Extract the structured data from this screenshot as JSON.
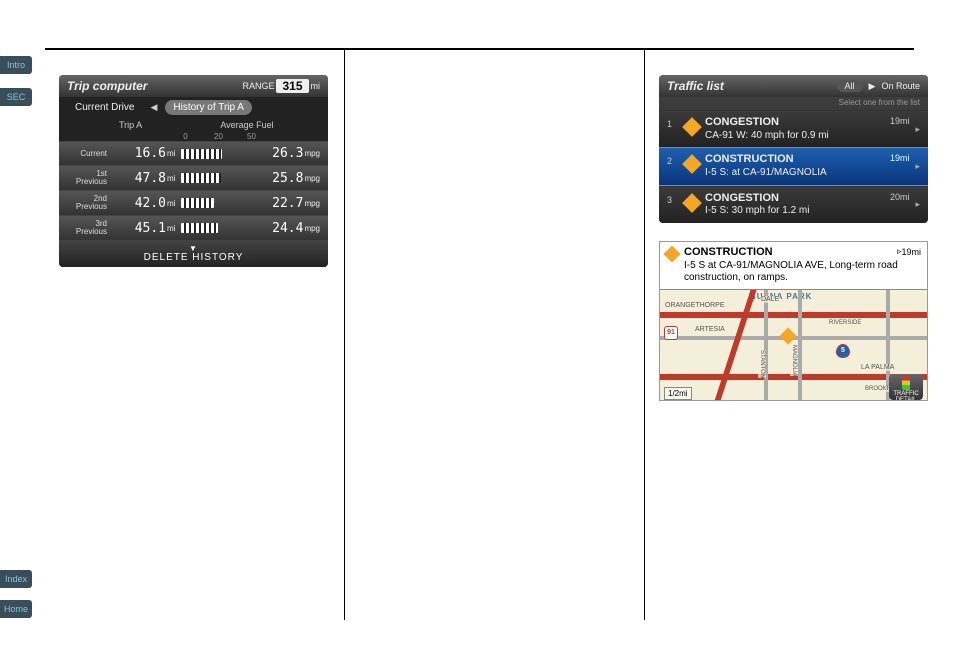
{
  "sideTabs": {
    "intro": "Intro",
    "sec": "SEC",
    "index": "Index",
    "home": "Home"
  },
  "tripComputer": {
    "title": "Trip computer",
    "rangeLabel": "RANGE",
    "rangeValue": "315",
    "rangeUnit": "mi",
    "tabLeft": "Current Drive",
    "tabRight": "History of Trip A",
    "colA": "Trip A",
    "colB": "Average Fuel",
    "scale": [
      "0",
      "20",
      "50"
    ],
    "rows": [
      {
        "label": "Current",
        "dist": "16.6",
        "distUnit": "mi",
        "mpg": "26.3",
        "mpgUnit": "mpg"
      },
      {
        "label": "1st Previous",
        "dist": "47.8",
        "distUnit": "mi",
        "mpg": "25.8",
        "mpgUnit": "mpg"
      },
      {
        "label": "2nd Previous",
        "dist": "42.0",
        "distUnit": "mi",
        "mpg": "22.7",
        "mpgUnit": "mpg"
      },
      {
        "label": "3rd Previous",
        "dist": "45.1",
        "distUnit": "mi",
        "mpg": "24.4",
        "mpgUnit": "mpg"
      }
    ],
    "footer": "DELETE HISTORY"
  },
  "trafficList": {
    "title": "Traffic list",
    "filterAll": "All",
    "filterRoute": "On Route",
    "subtitle": "Select one from the list",
    "items": [
      {
        "num": "1",
        "title": "CONGESTION",
        "desc": "CA-91 W: 40 mph for 0.9 mi",
        "dist": "19mi",
        "selected": false
      },
      {
        "num": "2",
        "title": "CONSTRUCTION",
        "desc": "I-5 S: at CA-91/MAGNOLIA",
        "dist": "19mi",
        "selected": true
      },
      {
        "num": "3",
        "title": "CONGESTION",
        "desc": "I-5 S: 30 mph for 1.2 mi",
        "dist": "20mi",
        "selected": false
      }
    ]
  },
  "mapDetail": {
    "title": "CONSTRUCTION",
    "dist": "19mi",
    "desc": "I-5 S at CA-91/MAGNOLIA AVE, Long-term road construction, on ramps.",
    "city": "BUENA PARK",
    "streets": {
      "orangethorpe": "ORANGETHORPE",
      "artesia": "ARTESIA",
      "lapalma": "LA PALMA",
      "dale": "DALE",
      "stanton": "STANTON",
      "magnolia": "MAGNOLIA",
      "riverside": "RIVERSIDE",
      "brookh": "BROOKH"
    },
    "shields": {
      "ca91": "91",
      "i5": "5"
    },
    "scale": "1/2mi",
    "detailBtn": "TRAFFIC DETAIL"
  }
}
